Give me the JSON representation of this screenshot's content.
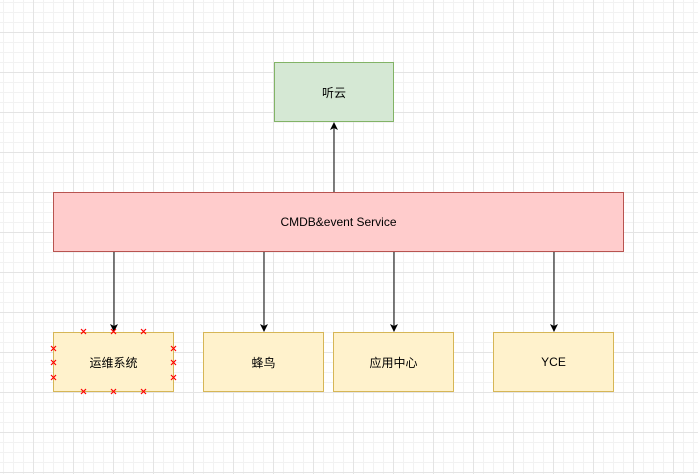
{
  "colors": {
    "green_fill": "#d5e8d4",
    "green_stroke": "#82b366",
    "red_fill": "#ffcccc",
    "red_stroke": "#b85450",
    "yellow_fill": "#fff2cc",
    "yellow_stroke": "#d6b656",
    "edge": "#000000",
    "selection_handle": "#ff0000"
  },
  "nodes": {
    "tingyun": {
      "label": "听云"
    },
    "cmdb": {
      "label": "CMDB&event Service"
    },
    "ops": {
      "label": "运维系统",
      "selected": true
    },
    "fengniao": {
      "label": "蜂鸟"
    },
    "appcenter": {
      "label": "应用中心"
    },
    "yce": {
      "label": "YCE"
    }
  },
  "edges": [
    {
      "from": "cmdb",
      "to": "tingyun"
    },
    {
      "from": "cmdb",
      "to": "ops"
    },
    {
      "from": "cmdb",
      "to": "fengniao"
    },
    {
      "from": "cmdb",
      "to": "appcenter"
    },
    {
      "from": "cmdb",
      "to": "yce"
    }
  ]
}
